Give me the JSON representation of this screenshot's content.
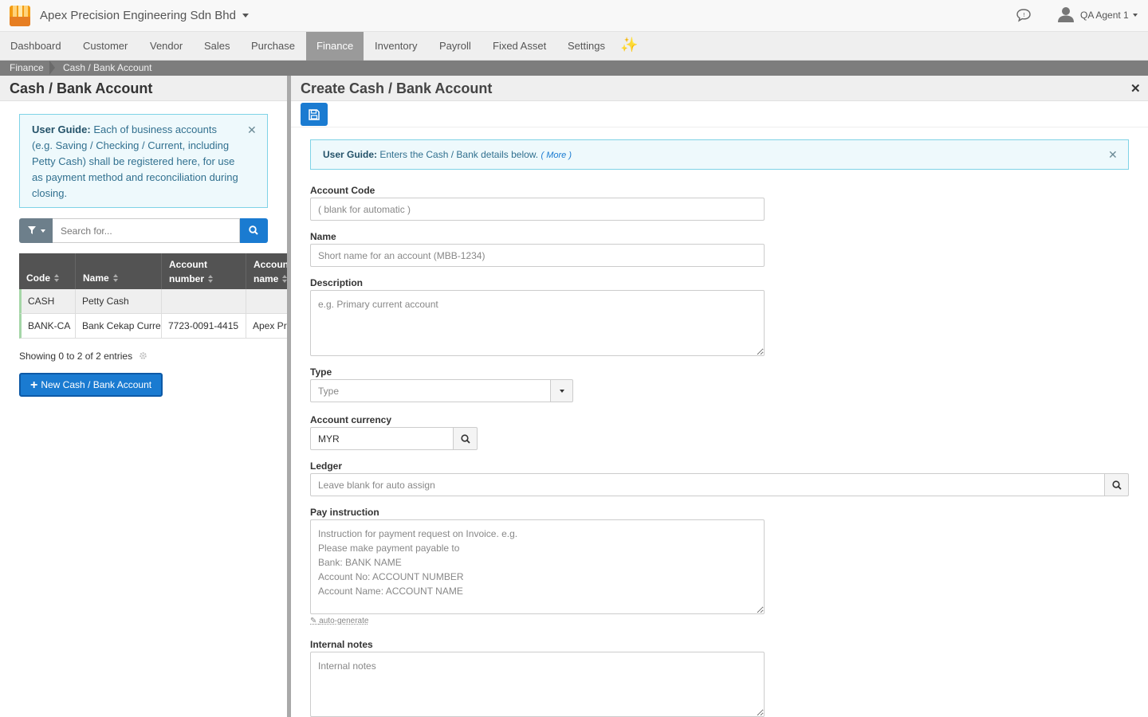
{
  "app": {
    "company": "Apex Precision Engineering Sdn Bhd",
    "user": "QA Agent 1",
    "brand_color": "#1a7bd1",
    "icons": {
      "logo": "store-logo-icon",
      "chat": "chat-bubble-icon",
      "user": "user-icon"
    }
  },
  "nav": {
    "items": [
      {
        "label": "Dashboard"
      },
      {
        "label": "Customer"
      },
      {
        "label": "Vendor"
      },
      {
        "label": "Sales"
      },
      {
        "label": "Purchase"
      },
      {
        "label": "Finance",
        "active": true
      },
      {
        "label": "Inventory"
      },
      {
        "label": "Payroll"
      },
      {
        "label": "Fixed Asset"
      },
      {
        "label": "Settings"
      }
    ],
    "extra_icon": "sparkles-icon"
  },
  "breadcrumb": [
    "Finance",
    "Cash / Bank Account"
  ],
  "left": {
    "title": "Cash / Bank Account",
    "guide_label": "User Guide:",
    "guide_text": "Each of business accounts (e.g. Saving / Checking / Current, including Petty Cash) shall be registered here, for use as payment method and reconciliation during closing.",
    "search_placeholder": "Search for...",
    "columns": [
      {
        "line1": "Code"
      },
      {
        "line1": "Name"
      },
      {
        "line1": "Account",
        "line2": "number"
      },
      {
        "line1": "Account",
        "line2": "name"
      }
    ],
    "rows": [
      {
        "code": "CASH",
        "name": "Petty Cash",
        "account_number": "",
        "account_name": ""
      },
      {
        "code": "BANK-CA",
        "name": "Bank Cekap Current",
        "account_number": "7723-0091-4415",
        "account_name": "Apex Precision Engineering Sdn Bhd"
      }
    ],
    "showing": "Showing 0 to 2 of 2 entries",
    "new_button": "New Cash / Bank Account"
  },
  "right": {
    "title": "Create Cash / Bank Account",
    "guide_label": "User Guide:",
    "guide_text": "Enters the Cash / Bank details below.",
    "guide_more": "( More )",
    "fields": {
      "account_code": {
        "label": "Account Code",
        "placeholder": "( blank for automatic )"
      },
      "name": {
        "label": "Name",
        "placeholder": "Short name for an account (MBB-1234)"
      },
      "description": {
        "label": "Description",
        "placeholder": "e.g. Primary current account"
      },
      "type": {
        "label": "Type",
        "placeholder": "Type"
      },
      "currency": {
        "label": "Account currency",
        "value": "MYR"
      },
      "ledger": {
        "label": "Ledger",
        "placeholder": "Leave blank for auto assign"
      },
      "pay_instruction": {
        "label": "Pay instruction",
        "placeholder": "Instruction for payment request on Invoice. e.g.\nPlease make payment payable to\nBank: BANK NAME\nAccount No: ACCOUNT NUMBER\nAccount Name: ACCOUNT NAME",
        "helper": "auto-generate"
      },
      "internal_notes": {
        "label": "Internal notes",
        "placeholder": "Internal notes"
      }
    }
  }
}
